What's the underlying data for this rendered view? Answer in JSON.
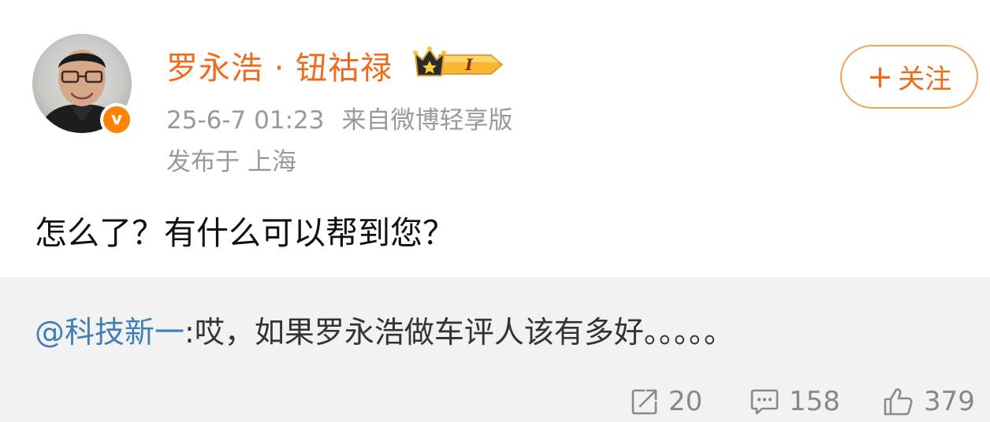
{
  "post": {
    "author": {
      "name": "罗永浩 · 钮祜禄",
      "verified_mark": "v",
      "badge_text": "I",
      "avatar_icon": "user-avatar"
    },
    "timestamp": "25-6-7 01:23",
    "source": "来自微博轻享版",
    "location": "发布于 上海",
    "follow_label": "关注",
    "follow_plus": "+",
    "text": "怎么了？有什么可以帮到您？"
  },
  "quote": {
    "mention": "@科技新一",
    "text": ":哎，如果罗永浩做车评人该有多好。。。。。"
  },
  "actions": {
    "reposts": "20",
    "comments": "158",
    "likes": "379"
  },
  "colors": {
    "accent": "#f06a1e",
    "mention": "#3f7fb8",
    "muted": "#999999",
    "quote_bg": "#f2f2f2"
  }
}
